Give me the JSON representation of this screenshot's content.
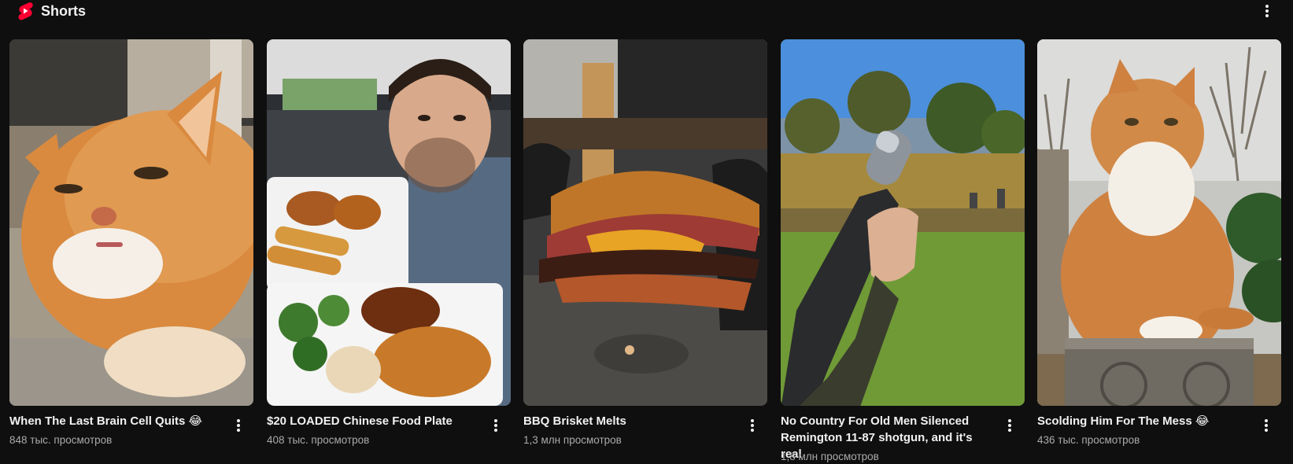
{
  "section": {
    "title": "Shorts",
    "logo_icon": "youtube-shorts-logo-icon",
    "menu_icon": "more-vertical-icon",
    "accent_color": "#ff0033"
  },
  "shorts": [
    {
      "title": "When The Last Brain Cell Quits 😂",
      "views": "848 тыс. просмотров",
      "thumbnail": "orange-cat-squinting"
    },
    {
      "title": "$20 LOADED Chinese Food Plate",
      "views": "408 тыс. просмотров",
      "thumbnail": "man-in-car-with-chinese-food"
    },
    {
      "title": "BBQ Brisket Melts",
      "views": "1,3 млн просмотров",
      "thumbnail": "brisket-grilled-cheese-sandwich"
    },
    {
      "title": "No Country For Old Men Silenced Remington 11-87 shotgun, and it's real",
      "views": "1,8 млн просмотров",
      "thumbnail": "silenced-shotgun-in-field"
    },
    {
      "title": "Scolding Him For The Mess 😂",
      "views": "436 тыс. просмотров",
      "thumbnail": "orange-cat-on-pillar"
    }
  ]
}
